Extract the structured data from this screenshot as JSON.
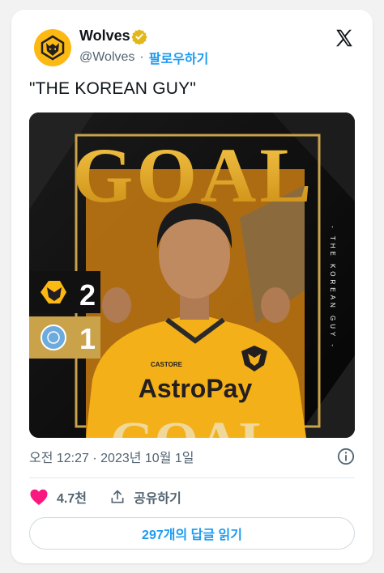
{
  "author": {
    "name": "Wolves",
    "handle": "@Wolves",
    "separator": "·",
    "follow_label": "팔로우하기"
  },
  "tweet": {
    "text": "\"THE KOREAN GUY\""
  },
  "media": {
    "headline": "GOAL",
    "score_home": "2",
    "score_away": "1",
    "side_text": "- THE KOREAN GUY -",
    "sponsor": "AstroPay",
    "kit_brand": "CASTORE"
  },
  "meta": {
    "timestamp": "오전 12:27 · 2023년 10월 1일"
  },
  "actions": {
    "likes": "4.7천",
    "share_label": "공유하기"
  },
  "replies": {
    "label": "297개의 답글 읽기"
  },
  "colors": {
    "brand_gold": "#fdb913",
    "link_blue": "#1d9bf0",
    "like_pink": "#f91880",
    "text_dark": "#0f1419",
    "text_gray": "#536471"
  },
  "icons": [
    "wolves-logo-icon",
    "verified-badge-icon",
    "x-logo-icon",
    "info-icon",
    "heart-icon",
    "share-icon",
    "city-crest-icon"
  ]
}
